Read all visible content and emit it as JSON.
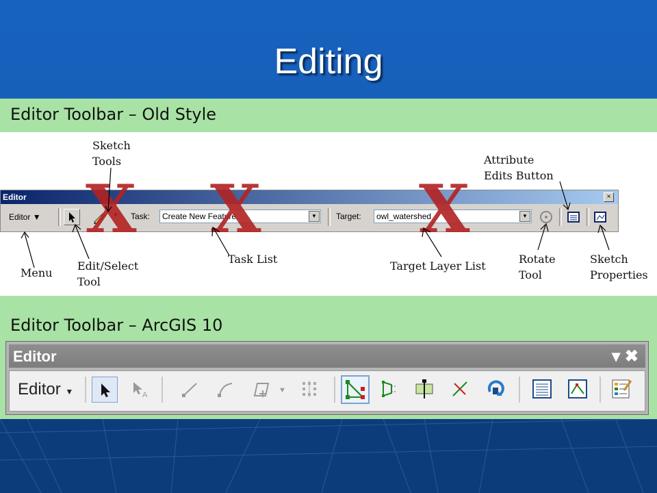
{
  "slide": {
    "title": "Editing"
  },
  "old_section": {
    "heading": "Editor Toolbar – Old Style",
    "toolbar": {
      "title": "Editor",
      "close_glyph": "×",
      "menu_label": "Editor",
      "task_label": "Task:",
      "task_value": "Create New Feature",
      "target_label": "Target:",
      "target_value": "owl_watershed"
    },
    "callouts": {
      "sketch_tools": "Sketch\nTools",
      "attribute_edits": "Attribute\nEdits Button",
      "menu": "Menu",
      "edit_select": "Edit/Select\nTool",
      "task_list": "Task List",
      "target_layer_list": "Target Layer List",
      "rotate_tool": "Rotate\nTool",
      "sketch_properties": "Sketch\nProperties"
    },
    "strike_marks": [
      "X",
      "X",
      "X"
    ]
  },
  "new_section": {
    "heading": "Editor Toolbar – ArcGIS 10",
    "toolbar": {
      "title": "Editor",
      "title_controls": "▾ ✖",
      "menu_label": "Editor",
      "buttons": [
        "edit-tool",
        "annotation-edit-tool",
        "straight-segment",
        "end-point-arc",
        "create-features-template",
        "cut-polygons",
        "edit-vertices",
        "reshape-feature",
        "cut-polygon",
        "split-tool",
        "rotate-tool",
        "attributes",
        "sketch-properties",
        "create-features-window"
      ]
    }
  },
  "colors": {
    "background": "#1762be",
    "band": "#a8e2a4",
    "strike_red": "#b22222"
  }
}
